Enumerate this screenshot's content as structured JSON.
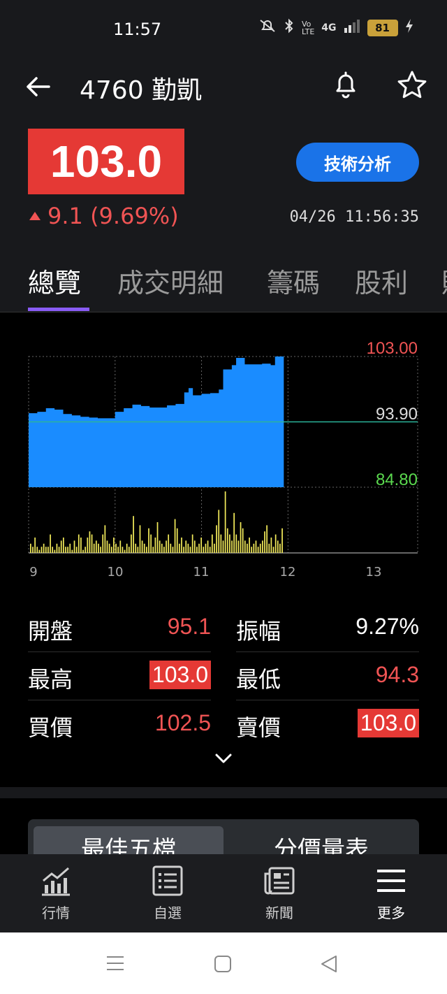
{
  "status_bar": {
    "time": "11:57",
    "signal": "4G",
    "battery": "81"
  },
  "header": {
    "title": "4760 勤凱",
    "price": "103.0",
    "change": "9.1 (9.69%)",
    "timestamp": "04/26 11:56:35",
    "tech_button": "技術分析"
  },
  "tabs": [
    {
      "label": "總覽"
    },
    {
      "label": "成交明細"
    },
    {
      "label": "籌碼"
    },
    {
      "label": "股利"
    }
  ],
  "chart_data": {
    "type": "area",
    "x_ticks": [
      "9",
      "10",
      "11",
      "12",
      "13"
    ],
    "y_labels": {
      "high": "103.00",
      "ref": "93.90",
      "low": "84.80"
    },
    "ylim": [
      84.8,
      103.0
    ],
    "reference": 93.9,
    "price_points": [
      {
        "t": 9.0,
        "v": 95.1
      },
      {
        "t": 9.1,
        "v": 95.3
      },
      {
        "t": 9.2,
        "v": 95.8
      },
      {
        "t": 9.3,
        "v": 95.6
      },
      {
        "t": 9.4,
        "v": 95.0
      },
      {
        "t": 9.5,
        "v": 94.8
      },
      {
        "t": 9.6,
        "v": 94.6
      },
      {
        "t": 9.7,
        "v": 94.5
      },
      {
        "t": 9.8,
        "v": 94.4
      },
      {
        "t": 9.9,
        "v": 94.4
      },
      {
        "t": 10.0,
        "v": 95.3
      },
      {
        "t": 10.1,
        "v": 95.8
      },
      {
        "t": 10.2,
        "v": 96.3
      },
      {
        "t": 10.3,
        "v": 96.1
      },
      {
        "t": 10.4,
        "v": 95.9
      },
      {
        "t": 10.5,
        "v": 95.9
      },
      {
        "t": 10.6,
        "v": 96.2
      },
      {
        "t": 10.7,
        "v": 96.4
      },
      {
        "t": 10.8,
        "v": 98.0
      },
      {
        "t": 10.85,
        "v": 98.6
      },
      {
        "t": 10.9,
        "v": 97.6
      },
      {
        "t": 11.0,
        "v": 97.8
      },
      {
        "t": 11.1,
        "v": 97.9
      },
      {
        "t": 11.2,
        "v": 98.4
      },
      {
        "t": 11.25,
        "v": 101.2
      },
      {
        "t": 11.35,
        "v": 101.8
      },
      {
        "t": 11.4,
        "v": 102.8
      },
      {
        "t": 11.5,
        "v": 101.9
      },
      {
        "t": 11.6,
        "v": 101.9
      },
      {
        "t": 11.7,
        "v": 102.0
      },
      {
        "t": 11.8,
        "v": 101.8
      },
      {
        "t": 11.85,
        "v": 103.0
      },
      {
        "t": 11.95,
        "v": 103.0
      }
    ],
    "volume": [
      3,
      2,
      5,
      2,
      1,
      2,
      3,
      2,
      2,
      6,
      2,
      1,
      3,
      2,
      4,
      5,
      2,
      2,
      3,
      1,
      4,
      2,
      6,
      5,
      1,
      2,
      5,
      7,
      6,
      3,
      4,
      3,
      2,
      6,
      9,
      4,
      3,
      2,
      5,
      3,
      2,
      4,
      2,
      1,
      3,
      2,
      6,
      12,
      3,
      2,
      9,
      4,
      3,
      2,
      8,
      6,
      2,
      5,
      10,
      4,
      3,
      2,
      4,
      6,
      3,
      2,
      11,
      8,
      3,
      5,
      2,
      4,
      3,
      2,
      6,
      4,
      2,
      3,
      5,
      2,
      3,
      4,
      2,
      6,
      3,
      9,
      14,
      6,
      4,
      20,
      8,
      6,
      4,
      13,
      6,
      4,
      10,
      8,
      4,
      3,
      5,
      2,
      3,
      4,
      2,
      3,
      4,
      7,
      9,
      3,
      5,
      2,
      6,
      4,
      3,
      8
    ]
  },
  "stats": [
    {
      "left_label": "開盤",
      "left_value": "95.1",
      "right_label": "振幅",
      "right_value": "9.27%"
    },
    {
      "left_label": "最高",
      "left_value": "103.0",
      "right_label": "最低",
      "right_value": "94.3"
    },
    {
      "left_label": "買價",
      "left_value": "102.5",
      "right_label": "賣價",
      "right_value": "103.0"
    }
  ],
  "segmented": {
    "option1": "最佳五檔",
    "option2": "分價量表"
  },
  "bottom_nav": [
    {
      "label": "行情"
    },
    {
      "label": "自選"
    },
    {
      "label": "新聞"
    },
    {
      "label": "更多"
    }
  ],
  "colors": {
    "up": "#f05454",
    "down": "#5bd94f",
    "area": "#1a8cff",
    "volume": "#f2ea5a",
    "accent": "#8a5cf6"
  }
}
